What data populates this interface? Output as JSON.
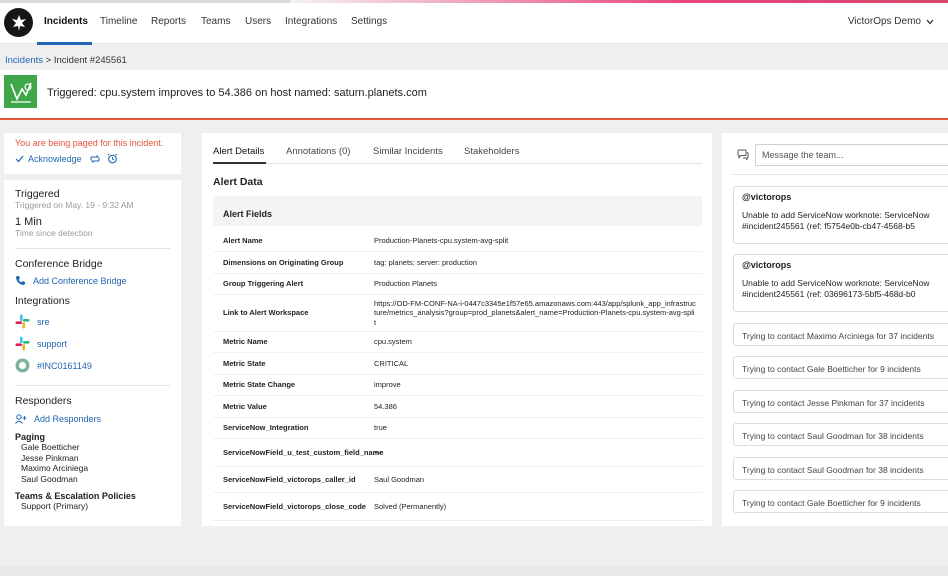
{
  "nav": {
    "tabs": [
      {
        "label": "Incidents"
      },
      {
        "label": "Timeline"
      },
      {
        "label": "Reports"
      },
      {
        "label": "Teams"
      },
      {
        "label": "Users"
      },
      {
        "label": "Integrations"
      },
      {
        "label": "Settings"
      }
    ],
    "active_tab": "Incidents",
    "account": "VictorOps Demo"
  },
  "breadcrumb": {
    "root": "Incidents",
    "separator": ">",
    "current": "Incident #245561"
  },
  "incident": {
    "title": "Triggered: cpu.system improves to 54.386 on host named: saturn.planets.com",
    "state_color": "#3fa64a"
  },
  "paging": {
    "notice": "You are being paged for this incident.",
    "acknowledge_label": "Acknowledge"
  },
  "status": {
    "state": "Triggered",
    "state_time": "Triggered on May. 19 - 9:32 AM",
    "duration": "1 Min",
    "duration_label": "Time since detection"
  },
  "conference": {
    "title": "Conference Bridge",
    "add_label": "Add Conference Bridge"
  },
  "integrations": {
    "title": "Integrations",
    "items": [
      {
        "label": "sre",
        "icon": "slack-icon"
      },
      {
        "label": "support",
        "icon": "slack-icon"
      },
      {
        "label": "#INC0161149",
        "icon": "servicenow-icon"
      }
    ]
  },
  "responders": {
    "title": "Responders",
    "add_label": "Add Responders",
    "paging_title": "Paging",
    "paging_list": [
      "Gale Boetticher",
      "Jesse Pinkman",
      "Maximo Arciniega",
      "Saul Goodman"
    ],
    "teams_title": "Teams & Escalation Policies",
    "teams_list": [
      "Support (Primary)"
    ]
  },
  "details_tabs": [
    {
      "label": "Alert Details"
    },
    {
      "label": "Annotations (0)"
    },
    {
      "label": "Similar Incidents"
    },
    {
      "label": "Stakeholders"
    }
  ],
  "alert_data": {
    "title": "Alert Data",
    "fields_title": "Alert Fields",
    "fields": [
      {
        "key": "Alert Name",
        "value": "Production-Planets-cpu.system-avg-split"
      },
      {
        "key": "Dimensions on Originating Group",
        "value": "tag: planets; server: production"
      },
      {
        "key": "Group Triggering Alert",
        "value": "Production Planets"
      },
      {
        "key": "Link to Alert Workspace",
        "value": "https://OD-FM-CONF-NA-i-0447c3345e1f57e65.amazonaws.com:443/app/splunk_app_infrastructure/metrics_analysis?group=prod_planets&alert_name=Production-Planets-cpu.system-avg-split"
      },
      {
        "key": "Metric Name",
        "value": "cpu.system"
      },
      {
        "key": "Metric State",
        "value": "CRITICAL"
      },
      {
        "key": "Metric State Change",
        "value": "improve"
      },
      {
        "key": "Metric Value",
        "value": "54.386"
      },
      {
        "key": "ServiceNow_Integration",
        "value": "true"
      },
      {
        "key": "ServiceNowField_u_test_custom_field_name",
        "value": "++"
      },
      {
        "key": "ServiceNowField_victorops_caller_id",
        "value": "Saul Goodman"
      },
      {
        "key": "ServiceNowField_victorops_close_code",
        "value": "Solved (Permanently)"
      }
    ]
  },
  "timeline": {
    "message_placeholder": "Message the team...",
    "notes": [
      {
        "author": "@victorops",
        "text_line1": "Unable to add ServiceNow worknote: ServiceNow",
        "text_line2": "#incident245561 (ref: f5754e0b-cb47-4568-b5"
      },
      {
        "author": "@victorops",
        "text_line1": "Unable to add ServiceNow worknote: ServiceNow",
        "text_line2": "#incident245561 (ref: 03696173-5bf5-468d-b0"
      }
    ],
    "contacts": [
      "Trying to contact Maximo Arciniega for 37 incidents",
      "Trying to contact Gale Boetticher for 9 incidents",
      "Trying to contact Jesse Pinkman for 37 incidents",
      "Trying to contact Saul Goodman for 38 incidents",
      "Trying to contact Saul Goodman for 38 incidents",
      "Trying to contact Gale Boetticher for 9 incidents"
    ]
  },
  "colors": {
    "accent": "#2166b2",
    "alert": "#e1543a",
    "success": "#3fa64a"
  }
}
